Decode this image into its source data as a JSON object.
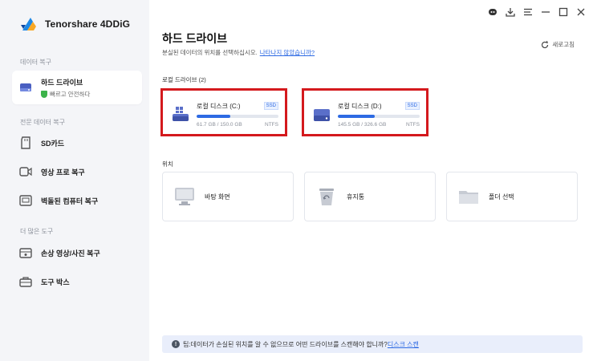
{
  "app": {
    "name": "Tenorshare 4DDiG"
  },
  "sidebar": {
    "section1": "데이터 복구",
    "section2": "전문 데이터 복구",
    "section3": "더 많은 도구",
    "items": [
      {
        "label": "하드 드라이브",
        "sub": "빠르고 안전하다",
        "icon": "hard-drive-icon"
      },
      {
        "label": "SD카드",
        "icon": "sd-card-icon"
      },
      {
        "label": "영상 프로 복구",
        "icon": "video-icon"
      },
      {
        "label": "벽돌된 컴퓨터 복구",
        "icon": "computer-icon"
      },
      {
        "label": "손상 영상/사진 복구",
        "icon": "repair-icon"
      },
      {
        "label": "도구 박스",
        "icon": "toolbox-icon"
      }
    ]
  },
  "main": {
    "title": "하드 드라이브",
    "subtitle": "분실된 데이터의 위치를 선택하십시오.",
    "subtitle_link": "나타나지 않았습니까?",
    "refresh_label": "새로고침",
    "local_drives_title": "로컬 드라이브 (2)",
    "location_title": "위치",
    "drives": [
      {
        "name": "로컬 디스크 (C:)",
        "badge": "SSD",
        "size": "61.7 GB / 150.0 GB",
        "fs": "NTFS",
        "used_fraction": 0.41
      },
      {
        "name": "로컬 디스크 (D:)",
        "badge": "SSD",
        "size": "145.5 GB / 326.6 GB",
        "fs": "NTFS",
        "used_fraction": 0.45
      }
    ],
    "locations": [
      {
        "label": "바탕 화면",
        "icon": "desktop-icon"
      },
      {
        "label": "휴지통",
        "icon": "recycle-bin-icon"
      },
      {
        "label": "폴더 선택",
        "icon": "folder-icon"
      }
    ],
    "tip_prefix": "팁:",
    "tip_text": " 데이터가 손실된 위치를 알 수 없으므로 어떤 드라이브를 스캔해야 합니까?",
    "tip_link": "디스크 스캔"
  },
  "colors": {
    "accent": "#2d6ae3",
    "highlight": "#d4191d"
  }
}
